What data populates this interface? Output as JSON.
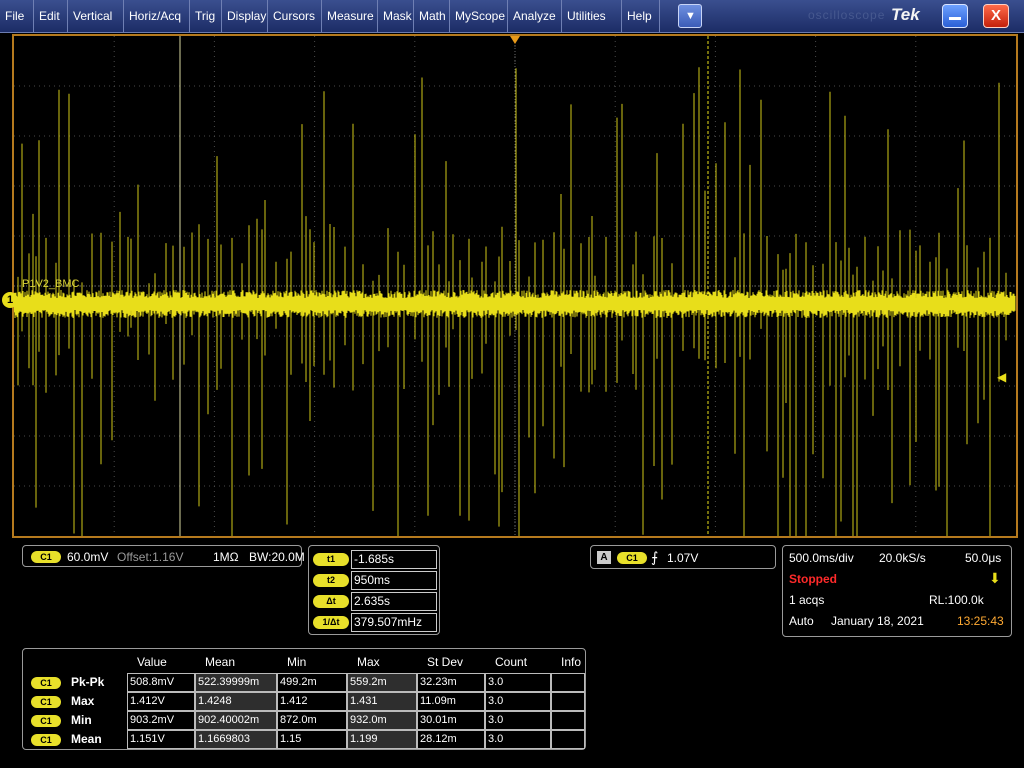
{
  "menu": {
    "items": [
      "File",
      "Edit",
      "Vertical",
      "Horiz/Acq",
      "Trig",
      "Display",
      "Cursors",
      "Measure",
      "Mask",
      "Math",
      "MyScope",
      "Analyze",
      "Utilities",
      "Help"
    ],
    "dropdown_icon": "chevron-down-icon",
    "brand": "Tek",
    "watermark": "oscilloscope",
    "close_label": "X"
  },
  "screen": {
    "channel_label": "P1V2_BMC",
    "channel_marker": "1",
    "trace_color": "#e8de1a",
    "frame_color": "#b57a1e"
  },
  "channel": {
    "badge": "C1",
    "scale": "60.0mV",
    "offset": "Offset:1.16V",
    "impedance": "1MΩ",
    "bw": "BW:20.0M"
  },
  "cursors": [
    {
      "label": "t1",
      "value": "-1.685s"
    },
    {
      "label": "t2",
      "value": "950ms"
    },
    {
      "label": "Δt",
      "value": "2.635s"
    },
    {
      "label": "1/Δt",
      "value": "379.507mHz"
    }
  ],
  "trigger": {
    "mode_badge": "A",
    "source": "C1",
    "slope_icon": "rising-edge-icon",
    "level": "1.07V"
  },
  "acquisition": {
    "time_div": "500.0ms/div",
    "sample_rate": "20.0kS/s",
    "resolution": "50.0μs",
    "state": "Stopped",
    "acqs": "1 acqs",
    "record_length": "RL:100.0k",
    "trigger_mode": "Auto",
    "date": "January 18, 2021",
    "time": "13:25:43",
    "stopped_color": "#ff2a2a",
    "time_color": "#ffaa33"
  },
  "measurements": {
    "headers": [
      "Value",
      "Mean",
      "Min",
      "Max",
      "St Dev",
      "Count",
      "Info"
    ],
    "rows": [
      {
        "badge": "C1",
        "name": "Pk-Pk",
        "values": [
          "508.8mV",
          "522.39999m",
          "499.2m",
          "559.2m",
          "32.23m",
          "3.0",
          ""
        ]
      },
      {
        "badge": "C1",
        "name": "Max",
        "values": [
          "1.412V",
          "1.4248",
          "1.412",
          "1.431",
          "11.09m",
          "3.0",
          ""
        ]
      },
      {
        "badge": "C1",
        "name": "Min",
        "values": [
          "903.2mV",
          "902.40002m",
          "872.0m",
          "932.0m",
          "30.01m",
          "3.0",
          ""
        ]
      },
      {
        "badge": "C1",
        "name": "Mean",
        "values": [
          "1.151V",
          "1.1669803",
          "1.15",
          "1.199",
          "28.12m",
          "3.0",
          ""
        ]
      }
    ]
  }
}
